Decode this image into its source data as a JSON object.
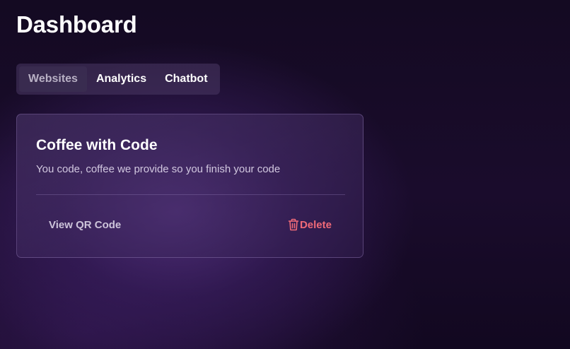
{
  "page": {
    "title": "Dashboard"
  },
  "tabs": [
    {
      "label": "Websites",
      "active": true
    },
    {
      "label": "Analytics",
      "active": false
    },
    {
      "label": "Chatbot",
      "active": false
    }
  ],
  "website_card": {
    "name": "Coffee with Code",
    "description": "You code, coffee we provide so you finish your code",
    "view_qr_label": "View QR Code",
    "delete_label": "Delete",
    "delete_icon": "trash-icon"
  },
  "colors": {
    "danger": "#f06a78",
    "tab_active_bg": "#3a2c50",
    "card_border": "#8c73af"
  }
}
